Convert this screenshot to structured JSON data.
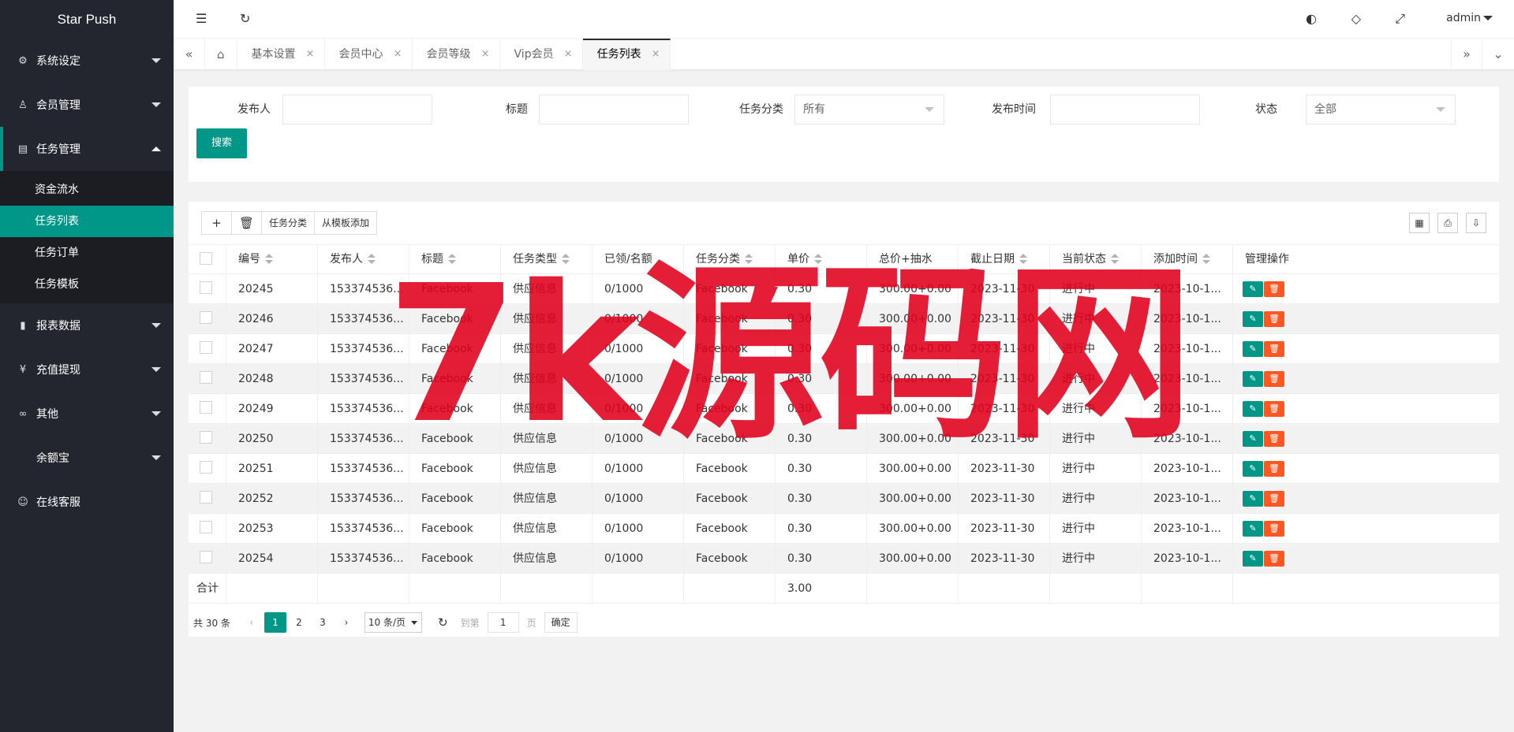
{
  "app": {
    "title": "Star Push"
  },
  "sidebar": {
    "items": [
      {
        "label": "系统设定",
        "icon": "gear-icon",
        "glyph": "⚙"
      },
      {
        "label": "会员管理",
        "icon": "user-icon",
        "glyph": "♙"
      },
      {
        "label": "任务管理",
        "icon": "document-icon",
        "glyph": "▤"
      },
      {
        "label": "报表数据",
        "icon": "chat-icon",
        "glyph": "▮"
      },
      {
        "label": "充值提现",
        "icon": "yen-icon",
        "glyph": "¥"
      },
      {
        "label": "其他",
        "icon": "link-icon",
        "glyph": "∞"
      },
      {
        "label": "余额宝",
        "icon": "",
        "glyph": ""
      },
      {
        "label": "在线客服",
        "icon": "headset-icon",
        "glyph": "☺"
      }
    ],
    "subitems": [
      {
        "label": "资金流水"
      },
      {
        "label": "任务列表"
      },
      {
        "label": "任务订单"
      },
      {
        "label": "任务模板"
      }
    ]
  },
  "header": {
    "user": "admin",
    "icons": {
      "menu": "☰",
      "refresh": "↻",
      "theme": "◐",
      "tag": "◇",
      "fullscreen": "⤢"
    }
  },
  "tabs": {
    "items": [
      {
        "label": "基本设置"
      },
      {
        "label": "会员中心"
      },
      {
        "label": "会员等级"
      },
      {
        "label": "Vip会员"
      },
      {
        "label": "任务列表"
      }
    ],
    "close": "×",
    "home": "⌂",
    "prev": "«",
    "next": "»",
    "more": "⌄"
  },
  "search": {
    "fields": [
      {
        "label": "发布人",
        "value": ""
      },
      {
        "label": "标题",
        "value": ""
      },
      {
        "label": "任务分类",
        "value": "所有"
      },
      {
        "label": "发布时间",
        "value": ""
      },
      {
        "label": "状态",
        "value": "全部"
      }
    ],
    "button": "搜索"
  },
  "toolbar": {
    "add": "+",
    "delete": "🗑",
    "category": "任务分类",
    "from_template": "从模板添加",
    "right_tools": [
      "▦",
      "⎙",
      "⇩"
    ]
  },
  "table": {
    "headers": [
      "编号",
      "发布人",
      "标题",
      "任务类型",
      "已领/名额",
      "任务分类",
      "单价",
      "总价+抽水",
      "截止日期",
      "当前状态",
      "添加时间",
      "管理操作"
    ],
    "rows": [
      [
        "20245",
        "153374536...",
        "Facebook",
        "供应信息",
        "0/1000",
        "Facebook",
        "0.30",
        "300.00+0.00",
        "2023-11-30",
        "进行中",
        "2023-10-1..."
      ],
      [
        "20246",
        "153374536...",
        "Facebook",
        "供应信息",
        "0/1000",
        "Facebook",
        "0.30",
        "300.00+0.00",
        "2023-11-30",
        "进行中",
        "2023-10-1..."
      ],
      [
        "20247",
        "153374536...",
        "Facebook",
        "供应信息",
        "0/1000",
        "Facebook",
        "0.30",
        "300.00+0.00",
        "2023-11-30",
        "进行中",
        "2023-10-1..."
      ],
      [
        "20248",
        "153374536...",
        "Facebook",
        "供应信息",
        "0/1000",
        "Facebook",
        "0.30",
        "300.00+0.00",
        "2023-11-30",
        "进行中",
        "2023-10-1..."
      ],
      [
        "20249",
        "153374536...",
        "Facebook",
        "供应信息",
        "0/1000",
        "Facebook",
        "0.30",
        "300.00+0.00",
        "2023-11-30",
        "进行中",
        "2023-10-1..."
      ],
      [
        "20250",
        "153374536...",
        "Facebook",
        "供应信息",
        "0/1000",
        "Facebook",
        "0.30",
        "300.00+0.00",
        "2023-11-30",
        "进行中",
        "2023-10-1..."
      ],
      [
        "20251",
        "153374536...",
        "Facebook",
        "供应信息",
        "0/1000",
        "Facebook",
        "0.30",
        "300.00+0.00",
        "2023-11-30",
        "进行中",
        "2023-10-1..."
      ],
      [
        "20252",
        "153374536...",
        "Facebook",
        "供应信息",
        "0/1000",
        "Facebook",
        "0.30",
        "300.00+0.00",
        "2023-11-30",
        "进行中",
        "2023-10-1..."
      ],
      [
        "20253",
        "153374536...",
        "Facebook",
        "供应信息",
        "0/1000",
        "Facebook",
        "0.30",
        "300.00+0.00",
        "2023-11-30",
        "进行中",
        "2023-10-1..."
      ],
      [
        "20254",
        "153374536...",
        "Facebook",
        "供应信息",
        "0/1000",
        "Facebook",
        "0.30",
        "300.00+0.00",
        "2023-11-30",
        "进行中",
        "2023-10-1..."
      ]
    ],
    "total_label": "合计",
    "total_price": "3.00",
    "edit_glyph": "✎",
    "delete_glyph": "🗑"
  },
  "pagination": {
    "total": "共 30 条",
    "prev": "‹",
    "next": "›",
    "pages": [
      "1",
      "2",
      "3"
    ],
    "page_size": "10 条/页",
    "refresh": "↻",
    "goto_label": "到第",
    "goto_value": "1",
    "page_unit": "页",
    "confirm": "确定"
  },
  "watermark": {
    "text": "7k源码网"
  },
  "colors": {
    "sidebar": "#23262e",
    "accent": "#009688",
    "danger": "#ff5722",
    "watermark": "#e0001b"
  }
}
